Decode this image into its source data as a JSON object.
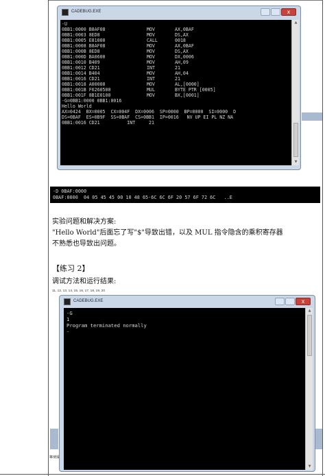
{
  "window1": {
    "title": "CADEBUG.EXE",
    "lines": [
      [
        "-U",
        "",
        "",
        ""
      ],
      [
        "0BB1:0000 B8AF08",
        "MOV",
        "AX,0BAF",
        ""
      ],
      [
        "0BB1:0003 8ED8",
        "MOV",
        "DS,AX",
        ""
      ],
      [
        "0BB1:0005 E81000",
        "CALL",
        "0018",
        ""
      ],
      [
        "0BB1:0008 B8AF08",
        "MOV",
        "AX,0BAF",
        ""
      ],
      [
        "0BB1:000B 8ED8",
        "MOV",
        "DS,AX",
        ""
      ],
      [
        "0BB1:000D BA0600",
        "MOV",
        "DX,0006",
        ""
      ],
      [
        "0BB1:0010 B409",
        "MOV",
        "AH,09",
        ""
      ],
      [
        "0BB1:0012 CD21",
        "INT",
        "21",
        ""
      ],
      [
        "0BB1:0014 B404",
        "MOV",
        "AH,04",
        ""
      ],
      [
        "0BB1:0016 CD21",
        "INT",
        "21",
        ""
      ],
      [
        "0BB1:0018 A00000",
        "MOV",
        "AL,[0000]",
        ""
      ],
      [
        "0BB1:001B F6260500",
        "MUL",
        "BYTE PTR [0005]",
        ""
      ],
      [
        "0BB1:001F 8B1E0100",
        "MOV",
        "BX,[0001]",
        ""
      ]
    ],
    "free_lines": [
      "-G=0BB1:0000 0BB1:0016",
      "Hello World",
      "AX=0424  BX=0005  CX=004F  DX=0006  SP=0000  BP=0000  SI=0000  D",
      "DS=0BAF  ES=0B9F  SS=0BAF  CS=0BB1  IP=0016   NV UP EI PL NZ NA",
      "0BB1:0016 CD21          INT     21"
    ]
  },
  "strip": {
    "lines": [
      "-D 0BAF:0000",
      "0BAF:0000  04 05 45 45 00 10 48 65-6C 6C 6F 20 57 6F 72 6C   ..E"
    ]
  },
  "text": {
    "heading1": "实验问题和解决方案:",
    "para1_line1": "\"Hello World\"后面忘了写\"$\"导致出错，以及 MUL 指令隐含的乘积寄存器",
    "para1_line2": "不熟悉也导致出问题。",
    "heading2": "【练习 2】",
    "heading3": "调试方法和运行结果:",
    "tiny": "11, 12, 13, 14, 15, 16, 17, 18, 19, 20",
    "stray": "等待操"
  },
  "window2": {
    "title": "CADEBUG.EXE",
    "lines": [
      "-G",
      "1",
      "Program terminated normally",
      "-"
    ]
  },
  "window_controls": {
    "close_glyph": "x"
  }
}
